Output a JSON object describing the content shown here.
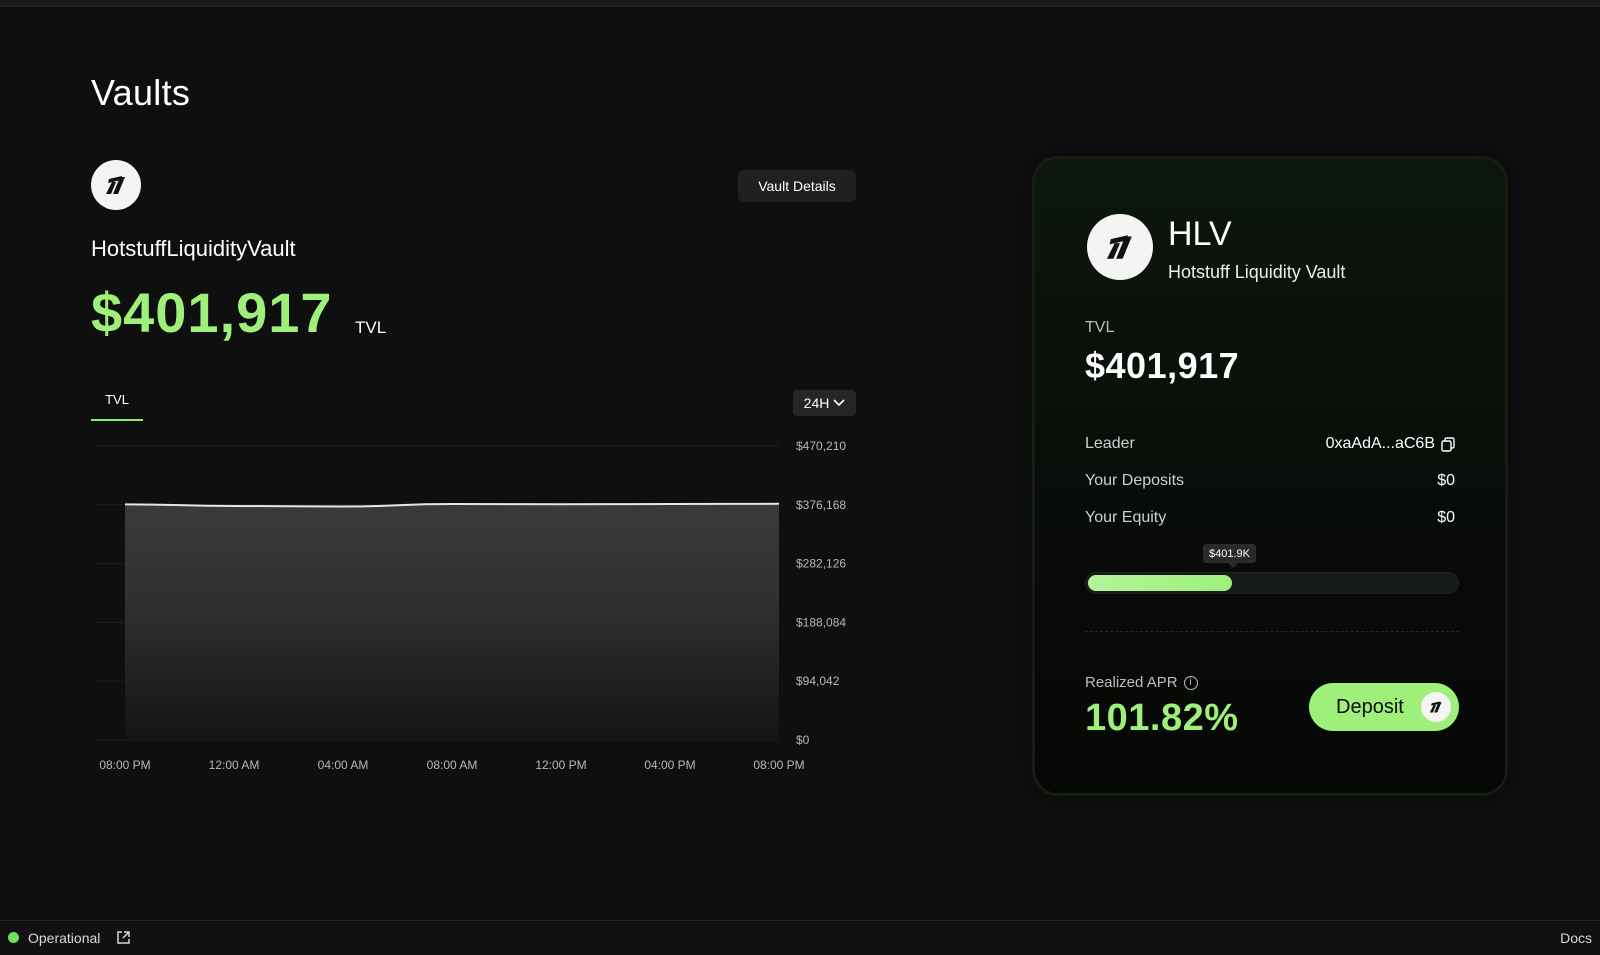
{
  "page": {
    "title": "Vaults"
  },
  "vault": {
    "details_button": "Vault Details",
    "name": "HotstuffLiquidityVault",
    "tvl_value": "$401,917",
    "tvl_suffix": "TVL",
    "tab_label": "TVL",
    "range_label": "24H"
  },
  "chart_data": {
    "type": "area",
    "title": "",
    "xlabel": "",
    "ylabel": "",
    "x": [
      "08:00 PM",
      "12:00 AM",
      "04:00 AM",
      "08:00 AM",
      "12:00 PM",
      "04:00 PM",
      "08:00 PM"
    ],
    "x_ticks": [
      "08:00 PM",
      "12:00 AM",
      "04:00 AM",
      "08:00 AM",
      "12:00 PM",
      "04:00 PM",
      "08:00 PM"
    ],
    "y_ticks": [
      "$470,210",
      "$376,168",
      "$282,126",
      "$188,084",
      "$94,042",
      "$0"
    ],
    "ylim": [
      0,
      470210
    ],
    "series": [
      {
        "values": [
          376900,
          374300,
          373500,
          377400,
          377000,
          377400,
          377800
        ]
      }
    ],
    "grid": true,
    "colors": {
      "line": "#e6e6e6",
      "fill_top": "#3a3a3a",
      "fill_bottom": "#141414"
    }
  },
  "card": {
    "ticker": "HLV",
    "full_name": "Hotstuff Liquidity Vault",
    "tvl_label": "TVL",
    "tvl_value": "$401,917",
    "rows": [
      {
        "label": "Leader",
        "value": "0xaAdA...aC6B"
      },
      {
        "label": "Your Deposits",
        "value": "$0"
      },
      {
        "label": "Your Equity",
        "value": "$0"
      }
    ],
    "progress_badge": "$401.9K",
    "progress_fraction": 0.39,
    "apr_label": "Realized APR",
    "apr_value": "101.82%",
    "deposit_button": "Deposit"
  },
  "footer": {
    "status": "Operational",
    "docs": "Docs"
  },
  "colors": {
    "accent": "#9ef07a",
    "background": "#0f0f0f",
    "status_ok": "#6ee05a"
  }
}
